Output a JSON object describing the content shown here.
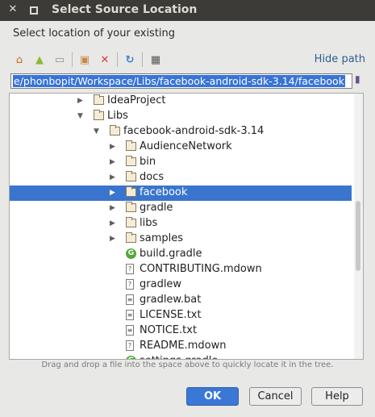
{
  "window": {
    "title": "Select Source Location"
  },
  "description": "Select location of your existing",
  "toolbar": {
    "icons": [
      "home-icon",
      "android-icon",
      "folder-icon",
      "new-folder-icon",
      "delete-icon",
      "refresh-icon",
      "show-hidden-icon"
    ],
    "hide_path_label": "Hide path"
  },
  "path": {
    "value": "e/phonbopit/Workspace/Libs/facebook-android-sdk-3.14/facebook"
  },
  "tree": {
    "rows": [
      {
        "label": "IdeaProject",
        "type": "folder",
        "state": "collapsed",
        "depth": 0
      },
      {
        "label": "Libs",
        "type": "folder",
        "state": "expanded",
        "depth": 0
      },
      {
        "label": "facebook-android-sdk-3.14",
        "type": "folder",
        "state": "expanded",
        "depth": 1
      },
      {
        "label": "AudienceNetwork",
        "type": "folder",
        "state": "collapsed",
        "depth": 2
      },
      {
        "label": "bin",
        "type": "folder",
        "state": "collapsed",
        "depth": 2
      },
      {
        "label": "docs",
        "type": "folder",
        "state": "collapsed",
        "depth": 2
      },
      {
        "label": "facebook",
        "type": "folder",
        "state": "collapsed",
        "depth": 2,
        "selected": true
      },
      {
        "label": "gradle",
        "type": "folder",
        "state": "collapsed",
        "depth": 2
      },
      {
        "label": "libs",
        "type": "folder",
        "state": "collapsed",
        "depth": 2
      },
      {
        "label": "samples",
        "type": "folder",
        "state": "collapsed",
        "depth": 2
      },
      {
        "label": "build.gradle",
        "type": "gradle",
        "depth": 2
      },
      {
        "label": "CONTRIBUTING.mdown",
        "type": "unknown",
        "depth": 2
      },
      {
        "label": "gradlew",
        "type": "unknown",
        "depth": 2
      },
      {
        "label": "gradlew.bat",
        "type": "text",
        "depth": 2
      },
      {
        "label": "LICENSE.txt",
        "type": "text",
        "depth": 2
      },
      {
        "label": "NOTICE.txt",
        "type": "text",
        "depth": 2
      },
      {
        "label": "README.mdown",
        "type": "unknown",
        "depth": 2
      },
      {
        "label": "settings.gradle",
        "type": "gradle",
        "depth": 2
      }
    ]
  },
  "hint": "Drag and drop a file into the space above to quickly locate it in the tree.",
  "buttons": {
    "ok": "OK",
    "cancel": "Cancel",
    "help": "Help"
  },
  "colors": {
    "selection": "#3a75cd",
    "link": "#2f5e8d",
    "titlebar": "#3c3b37"
  }
}
